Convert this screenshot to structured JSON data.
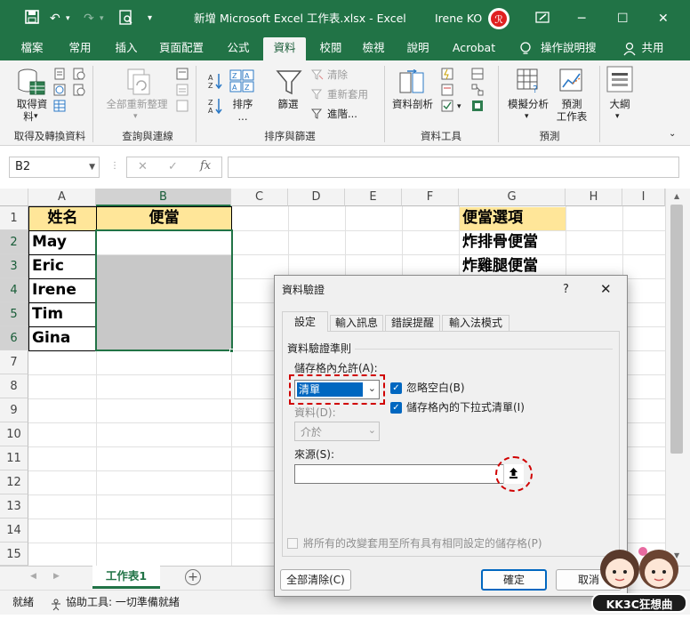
{
  "titlebar": {
    "title": "新增 Microsoft Excel 工作表.xlsx  -  Excel",
    "user": "Irene KO",
    "window_controls": [
      "─",
      "☐",
      "✕"
    ]
  },
  "tabs": [
    "檔案",
    "常用",
    "插入",
    "頁面配置",
    "公式",
    "資料",
    "校閱",
    "檢視",
    "說明",
    "Acrobat",
    "操作說明搜尋",
    "共用"
  ],
  "active_tab": "資料",
  "ribbon": {
    "get_data": "取得資",
    "get_data2": "料",
    "group_get": "取得及轉換資料",
    "refresh_all": "全部重新整理",
    "group_query": "查詢與連線",
    "sort": "排序",
    "sort_more": "...",
    "filter": "篩選",
    "clear": "清除",
    "reapply": "重新套用",
    "advanced": "進階...",
    "group_sort": "排序與篩選",
    "text_to_columns": "資料剖析",
    "group_tools": "資料工具",
    "what_if": "模擬分析",
    "forecast1": "預測",
    "forecast2": "工作表",
    "group_forecast": "預測",
    "outline": "大綱"
  },
  "formula_bar": {
    "name_box": "B2",
    "cancel": "✕",
    "enter": "✓",
    "fx": "fx",
    "value": ""
  },
  "columns": [
    "A",
    "B",
    "C",
    "D",
    "E",
    "F",
    "G",
    "H",
    "I"
  ],
  "rows": [
    "1",
    "2",
    "3",
    "4",
    "5",
    "6",
    "7",
    "8",
    "9",
    "10",
    "11",
    "12",
    "13",
    "14",
    "15"
  ],
  "cells": {
    "A1": "姓名",
    "B1": "便當",
    "A2": "May",
    "A3": "Eric",
    "A4": "Irene",
    "A5": "Tim",
    "A6": "Gina",
    "G1": "便當選項",
    "G2": "炸排骨便當",
    "G3": "炸雞腿便當"
  },
  "sheet_tab": "工作表1",
  "status": {
    "ready": "就緒",
    "accessibility": "協助工具: 一切準備就緒"
  },
  "dialog": {
    "title": "資料驗證",
    "help": "?",
    "close": "✕",
    "tabs": [
      "設定",
      "輸入訊息",
      "錯誤提醒",
      "輸入法模式"
    ],
    "criteria_label": "資料驗證準則",
    "allow_label": "儲存格內允許(A):",
    "allow_value": "清單",
    "ignore_blank": "忽略空白(B)",
    "in_cell_dropdown": "儲存格內的下拉式清單(I)",
    "data_label": "資料(D):",
    "data_value": "介於",
    "source_label": "來源(S):",
    "source_value": "",
    "apply_all": "將所有的改變套用至所有具有相同設定的儲存格(P)",
    "clear_all": "全部清除(C)",
    "ok": "確定",
    "cancel": "取消"
  },
  "watermark": "KK3C狂想曲",
  "colors": {
    "excel_green": "#217346",
    "header_fill": "#ffe699",
    "selection_gray": "#c8c8c8",
    "highlight_red": "#d00000",
    "accent_blue": "#0067c0"
  }
}
